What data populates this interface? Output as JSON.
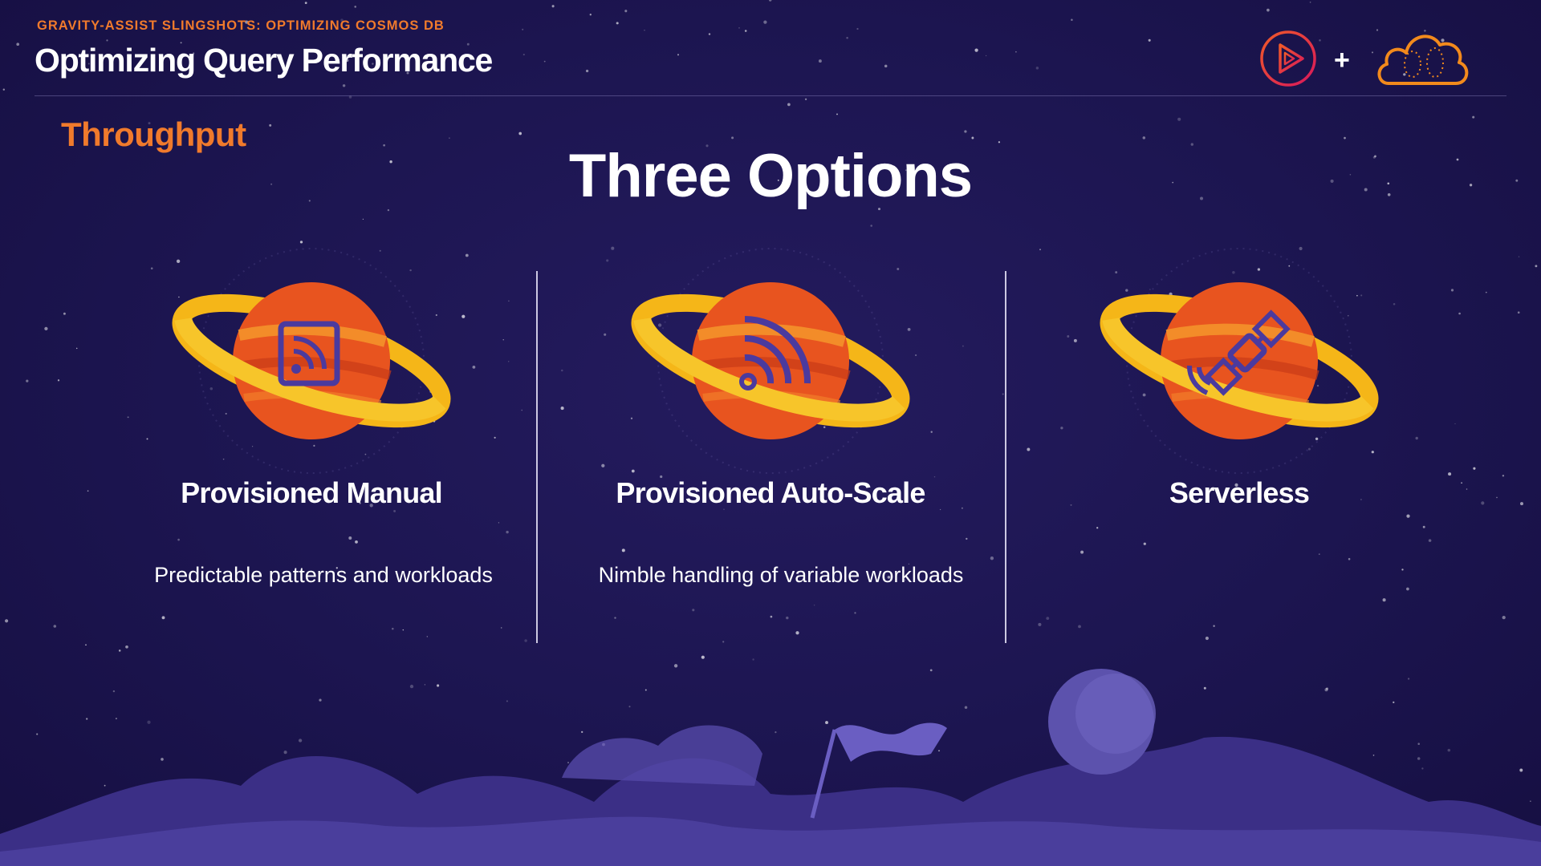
{
  "header": {
    "kicker": "GRAVITY-ASSIST SLINGSHOTS: OPTIMIZING COSMOS DB",
    "title": "Optimizing Query Performance",
    "logos": [
      {
        "icon": "play-logo-icon",
        "color": "#e8254a"
      },
      {
        "icon": "plus-icon",
        "text": "+"
      },
      {
        "icon": "cloud-brain-icon",
        "color": "#f28a1c"
      }
    ]
  },
  "slide": {
    "section_label": "Throughput",
    "title": "Three Options"
  },
  "options": [
    {
      "title": "Provisioned Manual",
      "description": "Predictable patterns and workloads",
      "icon": "rss-feed-icon"
    },
    {
      "title": "Provisioned Auto-Scale",
      "description": "Nimble handling of variable workloads",
      "icon": "wifi-signal-icon"
    },
    {
      "title": "Serverless",
      "description": "",
      "icon": "satellite-icon"
    }
  ],
  "colors": {
    "background": "#1d1650",
    "accent_orange": "#f07a2c",
    "planet_orange": "#e8541f",
    "ring_yellow": "#f5b618",
    "icon_purple": "#4b3a9e",
    "text": "#ffffff"
  }
}
